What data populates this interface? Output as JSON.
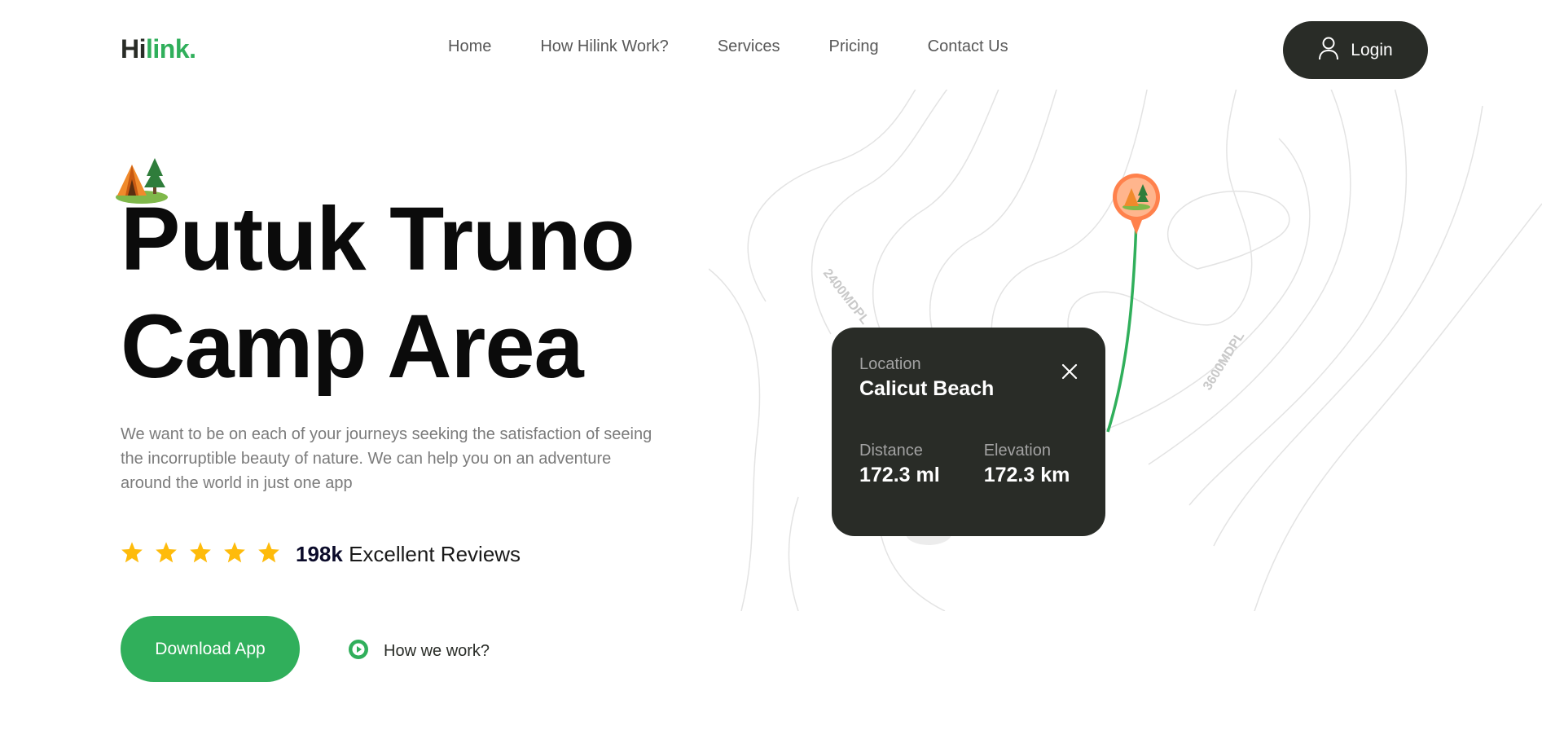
{
  "header": {
    "logo_hi": "Hi",
    "logo_link": "link.",
    "nav": [
      "Home",
      "How Hilink Work?",
      "Services",
      "Pricing",
      "Contact Us"
    ],
    "login_label": "Login"
  },
  "hero": {
    "title_line1": "Putuk Truno",
    "title_line2": "Camp Area",
    "description": "We want to be on each of your journeys seeking the satisfaction of seeing the incorruptible beauty of nature. We can help you on an adventure around the world in just one app",
    "rating_stars": 5,
    "reviews_count": "198k",
    "reviews_label": "Excellent Reviews",
    "download_label": "Download App",
    "how_label": "How we work?"
  },
  "map": {
    "label_left": "2400MDPL",
    "label_right": "3600MDPL",
    "card": {
      "location_label": "Location",
      "location_value": "Calicut Beach",
      "distance_label": "Distance",
      "distance_value": "172.3 ml",
      "elevation_label": "Elevation",
      "elevation_value": "172.3 km"
    }
  },
  "colors": {
    "brand_green": "#30af5b",
    "dark": "#292c27",
    "star": "#febb0b",
    "pin": "#ff814c"
  },
  "icons": [
    "camp-icon",
    "user-icon",
    "star-icon",
    "play-icon",
    "close-icon",
    "map-pin-icon"
  ]
}
